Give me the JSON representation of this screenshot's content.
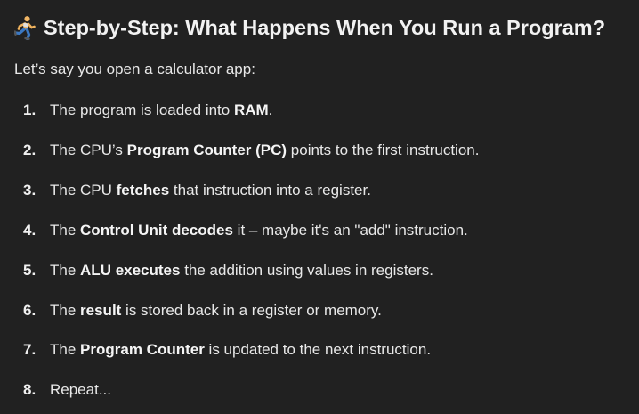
{
  "heading": {
    "icon": "person-running-icon",
    "title": "Step-by-Step: What Happens When You Run a Program?"
  },
  "intro": "Let’s say you open a calculator app:",
  "steps": [
    {
      "number": "1.",
      "parts": [
        {
          "text": "The program is loaded into ",
          "bold": false
        },
        {
          "text": "RAM",
          "bold": true
        },
        {
          "text": ".",
          "bold": false
        }
      ]
    },
    {
      "number": "2.",
      "parts": [
        {
          "text": "The CPU’s ",
          "bold": false
        },
        {
          "text": "Program Counter (PC)",
          "bold": true
        },
        {
          "text": " points to the first instruction.",
          "bold": false
        }
      ]
    },
    {
      "number": "3.",
      "parts": [
        {
          "text": "The CPU ",
          "bold": false
        },
        {
          "text": "fetches",
          "bold": true
        },
        {
          "text": " that instruction into a register.",
          "bold": false
        }
      ]
    },
    {
      "number": "4.",
      "parts": [
        {
          "text": "The ",
          "bold": false
        },
        {
          "text": "Control Unit decodes",
          "bold": true
        },
        {
          "text": " it – maybe it's an \"add\" instruction.",
          "bold": false
        }
      ]
    },
    {
      "number": "5.",
      "parts": [
        {
          "text": "The ",
          "bold": false
        },
        {
          "text": "ALU executes",
          "bold": true
        },
        {
          "text": " the addition using values in registers.",
          "bold": false
        }
      ]
    },
    {
      "number": "6.",
      "parts": [
        {
          "text": "The ",
          "bold": false
        },
        {
          "text": "result",
          "bold": true
        },
        {
          "text": " is stored back in a register or memory.",
          "bold": false
        }
      ]
    },
    {
      "number": "7.",
      "parts": [
        {
          "text": "The ",
          "bold": false
        },
        {
          "text": "Program Counter",
          "bold": true
        },
        {
          "text": " is updated to the next instruction.",
          "bold": false
        }
      ]
    },
    {
      "number": "8.",
      "parts": [
        {
          "text": "Repeat...",
          "bold": false
        }
      ]
    }
  ]
}
